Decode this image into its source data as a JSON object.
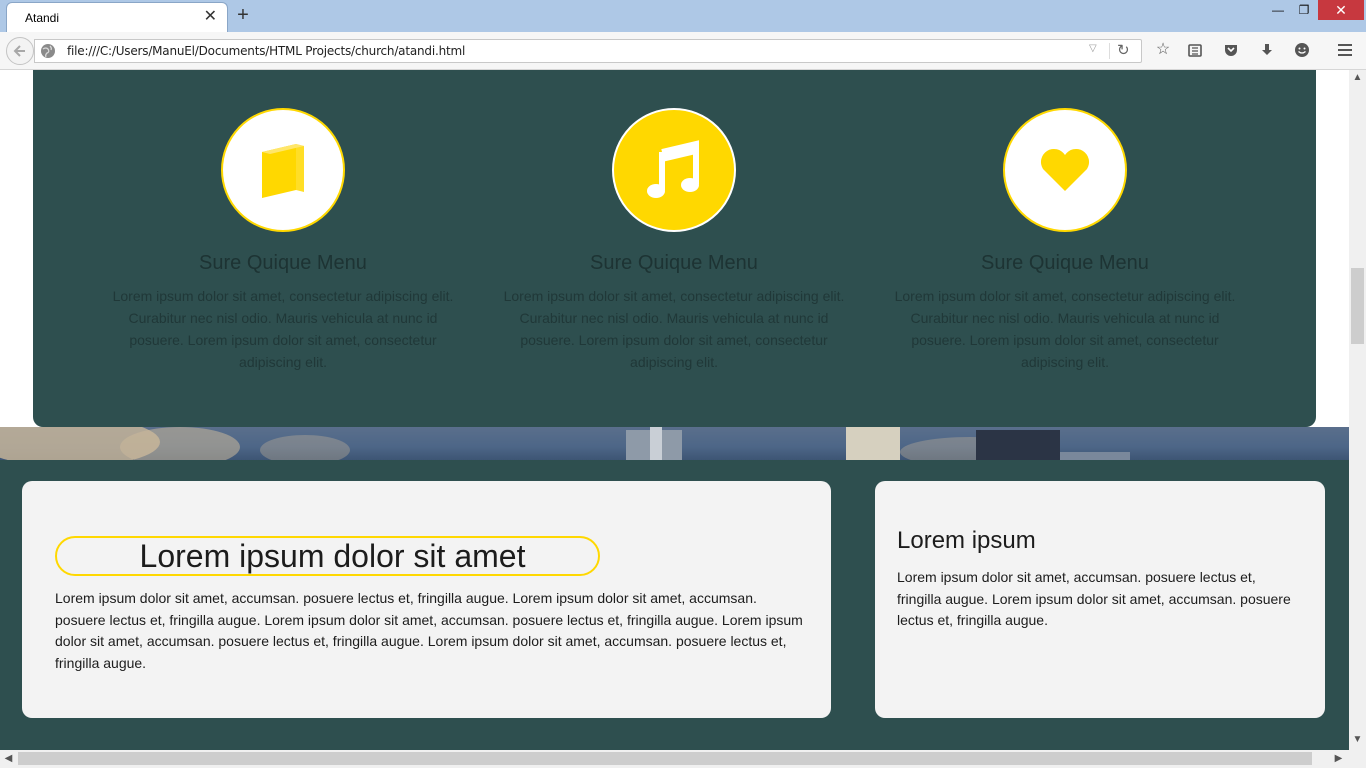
{
  "browser": {
    "tab_title": "Atandi",
    "tab_close": "✕",
    "new_tab": "+",
    "url": "file:///C:/Users/ManuEl/Documents/HTML Projects/church/atandi.html",
    "window_min": "—",
    "window_max": "❐",
    "window_close": "✕"
  },
  "features": [
    {
      "icon": "book-icon",
      "title": "Sure Quique Menu",
      "text": "Lorem ipsum dolor sit amet, consectetur adipiscing elit. Curabitur nec nisl odio. Mauris vehicula at nunc id posuere. Lorem ipsum dolor sit amet, consectetur adipiscing elit."
    },
    {
      "icon": "music-icon",
      "title": "Sure Quique Menu",
      "text": "Lorem ipsum dolor sit amet, consectetur adipiscing elit. Curabitur nec nisl odio. Mauris vehicula at nunc id posuere. Lorem ipsum dolor sit amet, consectetur adipiscing elit."
    },
    {
      "icon": "heart-icon",
      "title": "Sure Quique Menu",
      "text": "Lorem ipsum dolor sit amet, consectetur adipiscing elit. Curabitur nec nisl odio. Mauris vehicula at nunc id posuere. Lorem ipsum dolor sit amet, consectetur adipiscing elit."
    }
  ],
  "main_card": {
    "heading": "Lorem ipsum dolor sit amet",
    "body": "Lorem ipsum dolor sit amet, accumsan. posuere lectus et, fringilla augue. Lorem ipsum dolor sit amet, accumsan. posuere lectus et, fringilla augue. Lorem ipsum dolor sit amet, accumsan. posuere lectus et, fringilla augue. Lorem ipsum dolor sit amet, accumsan. posuere lectus et, fringilla augue. Lorem ipsum dolor sit amet, accumsan. posuere lectus et, fringilla augue."
  },
  "side_card": {
    "heading": "Lorem ipsum",
    "body": "Lorem ipsum dolor sit amet, accumsan. posuere lectus et, fringilla augue. Lorem ipsum dolor sit amet, accumsan. posuere lectus et, fringilla augue."
  },
  "colors": {
    "accent": "#ffd800",
    "panel": "#2e4f4f",
    "card": "#f3f3f3"
  }
}
